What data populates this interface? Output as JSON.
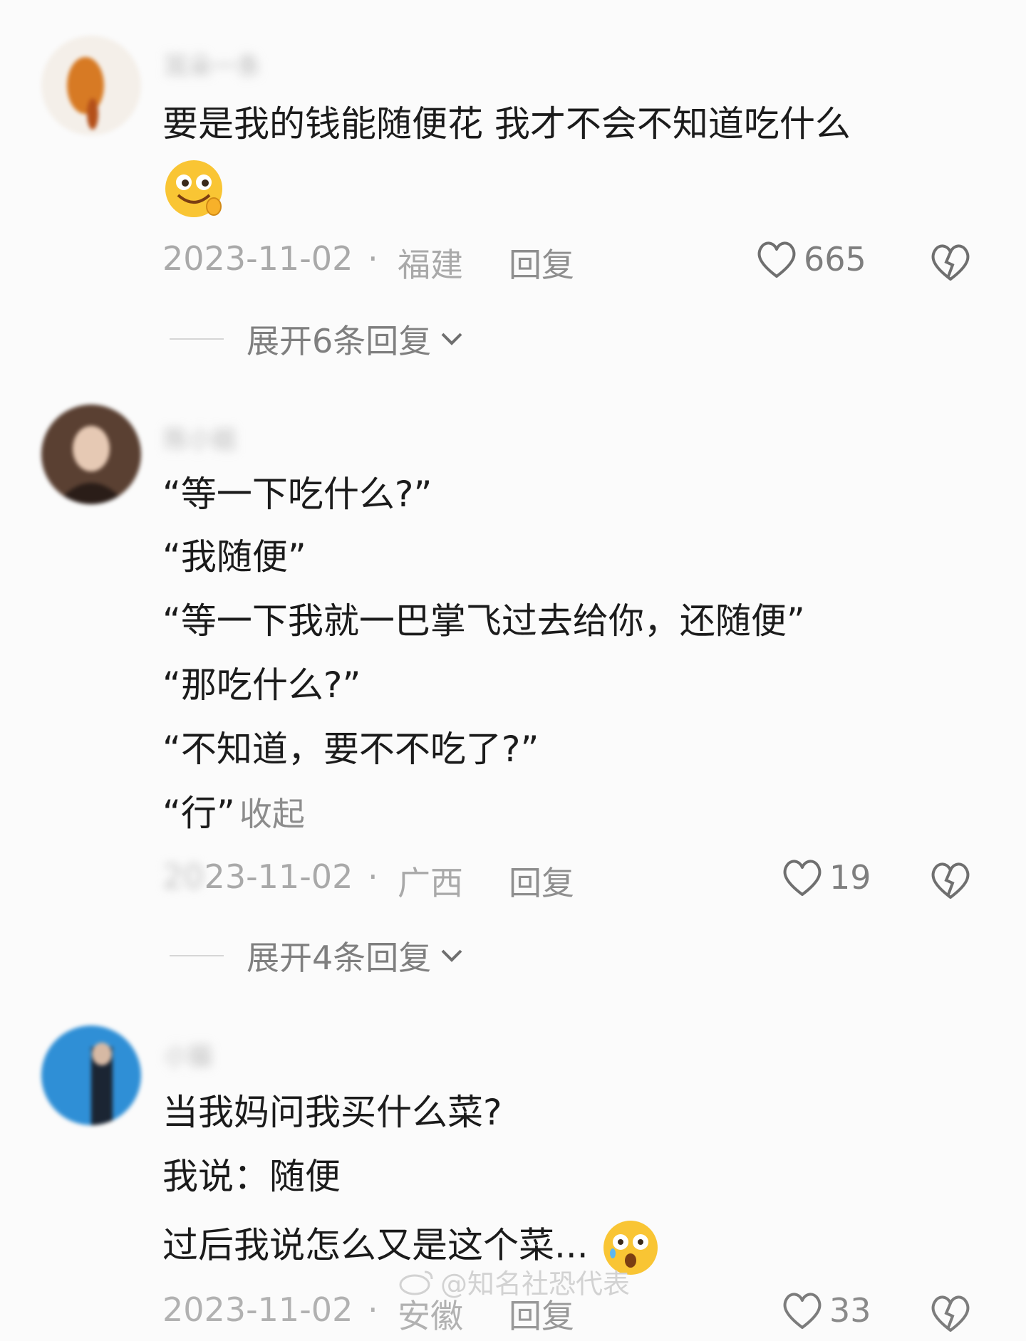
{
  "comments": [
    {
      "username": "耳朵一条",
      "lines": [
        "要是我的钱能随便花 我才不会不知道吃什么"
      ],
      "emoji": "drooling-face-emoji",
      "date": "2023-11-02",
      "location": "福建",
      "reply_label": "回复",
      "likes": "665",
      "expand_label": "展开6条回复"
    },
    {
      "username": "陈小姐",
      "lines": [
        "“等一下吃什么?”",
        "“我随便”",
        "“等一下我就一巴掌飞过去给你，还随便”",
        "“那吃什么?”",
        "“不知道，要不不吃了?”",
        "“行”"
      ],
      "collapse_label": "收起",
      "date_hidden_prefix": "20",
      "date_visible": "23-11-02",
      "location": "广西",
      "reply_label": "回复",
      "likes": "19",
      "expand_label": "展开4条回复"
    },
    {
      "username": "小猫",
      "lines": [
        "当我妈问我买什么菜?",
        "我说：随便",
        "过后我说怎么又是这个菜..."
      ],
      "emoji": "shocked-face-emoji",
      "date": "2023-11-02",
      "location": "安徽",
      "reply_label": "回复",
      "likes": "33"
    }
  ],
  "watermark": "@知名社恐代表",
  "colors": {
    "background": "#fbfbfb",
    "text": "#1b1b1b",
    "meta": "#a9a9a9",
    "icon": "#6f6f6f"
  }
}
